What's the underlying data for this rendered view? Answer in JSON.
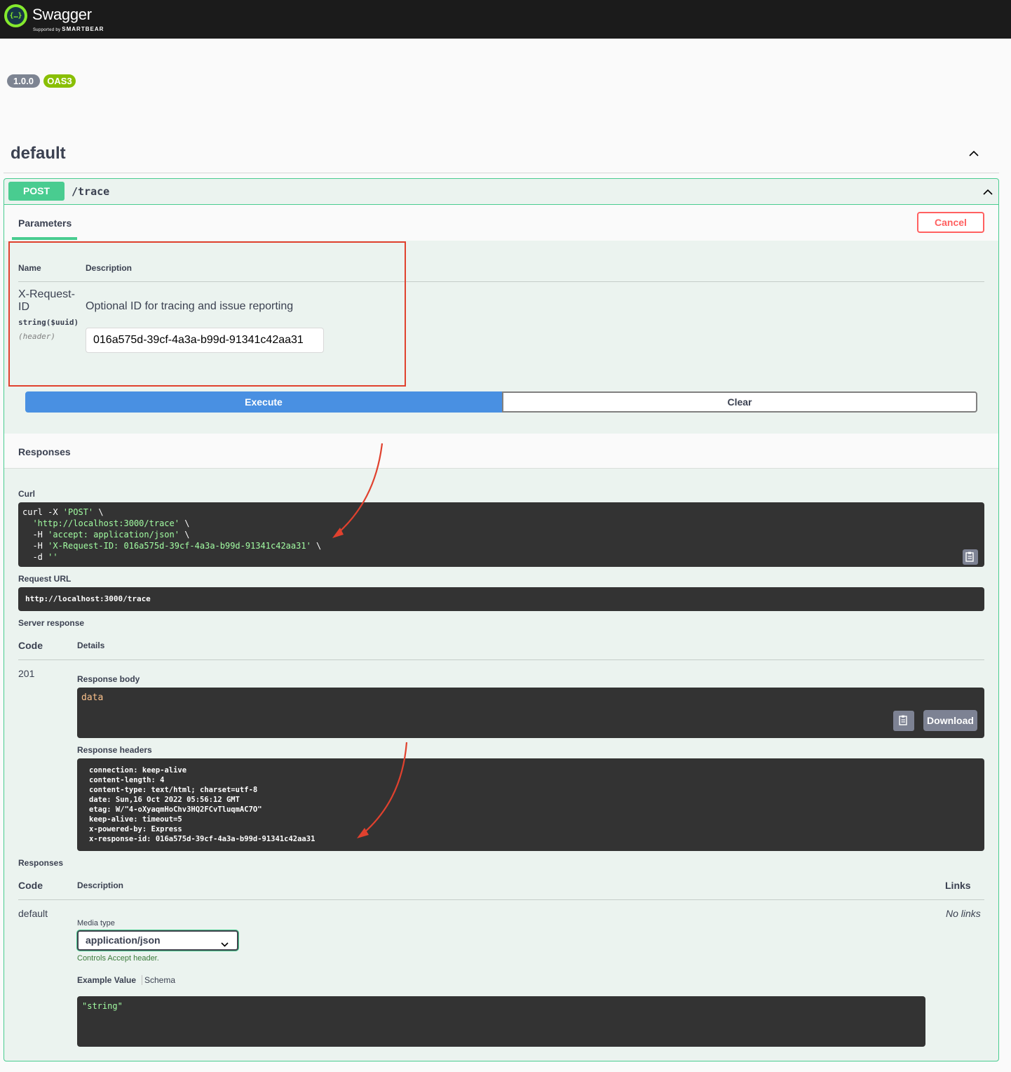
{
  "header": {
    "logo_glyph": "{…}",
    "brand": "Swagger",
    "brand_sub_prefix": "Supported by",
    "brand_sub_company": "SMARTBEAR"
  },
  "info": {
    "version_badge": "1.0.0",
    "oas_badge": "OAS3"
  },
  "section": {
    "title": "default"
  },
  "operation": {
    "method": "POST",
    "path": "/trace",
    "tab_parameters": "Parameters",
    "cancel_label": "Cancel",
    "param_table": {
      "col_name": "Name",
      "col_description": "Description"
    },
    "parameter": {
      "name": "X-Request-ID",
      "type": "string($uuid)",
      "in": "(header)",
      "description": "Optional ID for tracing and issue reporting",
      "value": "016a575d-39cf-4a3a-b99d-91341c42aa31"
    },
    "execute_label": "Execute",
    "clear_label": "Clear"
  },
  "live_responses": {
    "title": "Responses",
    "curl_label": "Curl",
    "curl_lines": [
      {
        "cmd": "curl -X ",
        "str": "'POST'",
        "tail": " \\"
      },
      {
        "cmd": "  ",
        "str": "'http://localhost:3000/trace'",
        "tail": " \\"
      },
      {
        "cmd": "  -H ",
        "str": "'accept: application/json'",
        "tail": " \\"
      },
      {
        "cmd": "  -H ",
        "str": "'X-Request-ID: 016a575d-39cf-4a3a-b99d-91341c42aa31'",
        "tail": " \\"
      },
      {
        "cmd": "  -d ",
        "str": "''",
        "tail": ""
      }
    ],
    "request_url_label": "Request URL",
    "request_url": "http://localhost:3000/trace",
    "server_response_label": "Server response",
    "col_code": "Code",
    "col_details": "Details",
    "code": "201",
    "response_body_label": "Response body",
    "response_body": "data",
    "download_label": "Download",
    "response_headers_label": "Response headers",
    "response_headers": [
      "connection: keep-alive",
      "content-length: 4",
      "content-type: text/html; charset=utf-8",
      "date: Sun,16 Oct 2022 05:56:12 GMT",
      "etag: W/\"4-oXyaqmHoChv3HQ2FCvTluqmAC7O\"",
      "keep-alive: timeout=5",
      "x-powered-by: Express",
      "x-response-id: 016a575d-39cf-4a3a-b99d-91341c42aa31"
    ]
  },
  "documented_responses": {
    "title": "Responses",
    "col_code": "Code",
    "col_description": "Description",
    "col_links": "Links",
    "code": "default",
    "links_value": "No links",
    "media_type_label": "Media type",
    "media_type_value": "application/json",
    "controls_note": "Controls Accept header.",
    "tab_example": "Example Value",
    "tab_schema": "Schema",
    "example_value": "\"string\""
  },
  "colors": {
    "post_green": "#49cc90",
    "execute_blue": "#4990e2",
    "cancel_red": "#ff6060",
    "annotation_red": "#e0412e"
  }
}
